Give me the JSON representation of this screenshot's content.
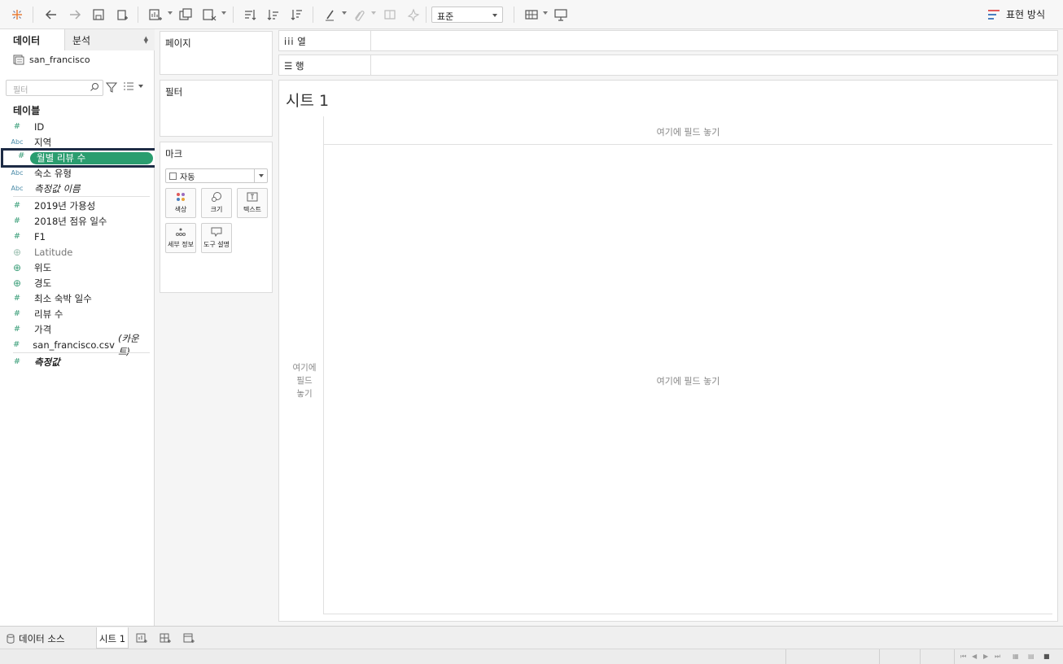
{
  "toolbar": {
    "fit_value": "표준",
    "show_me_label": "표현 방식"
  },
  "data_pane": {
    "tab_data": "데이터",
    "tab_analysis": "분석",
    "datasource_name": "san_francisco",
    "search_placeholder": "필터",
    "tables_header": "테이블",
    "fields": [
      {
        "label": "ID",
        "type": "measure"
      },
      {
        "label": "지역",
        "type": "dimension"
      },
      {
        "label": "월별 리뷰 수",
        "type": "measure",
        "selected": true
      },
      {
        "label": "숙소 유형",
        "type": "dimension"
      },
      {
        "label": "측정값 이름",
        "type": "dimension",
        "italic": true
      },
      {
        "label": "2019년 가용성",
        "type": "measure"
      },
      {
        "label": "2018년 점유 일수",
        "type": "measure"
      },
      {
        "label": "F1",
        "type": "measure"
      },
      {
        "label": "Latitude",
        "type": "geo"
      },
      {
        "label": "위도",
        "type": "geo"
      },
      {
        "label": "경도",
        "type": "geo"
      },
      {
        "label": "최소 숙박 일수",
        "type": "measure"
      },
      {
        "label": "리뷰 수",
        "type": "measure"
      },
      {
        "label": "가격",
        "type": "measure"
      },
      {
        "label": "san_francisco.csv",
        "suffix": "(카운트)",
        "type": "measure"
      },
      {
        "label": "측정값",
        "type": "measure",
        "italic": true
      }
    ]
  },
  "shelves": {
    "pages": "페이지",
    "filters": "필터",
    "marks": "마크",
    "mark_type": "자동",
    "mark_buttons": {
      "color": "색상",
      "size": "크기",
      "text": "텍스트",
      "detail": "세부 정보",
      "tooltip": "도구 설명"
    },
    "columns": "열",
    "rows": "행"
  },
  "canvas": {
    "sheet_title": "시트 1",
    "drop_field_cols": "여기에 필드 놓기",
    "drop_field_rows_1": "여기에",
    "drop_field_rows_2": "필드",
    "drop_field_rows_3": "놓기",
    "drop_field_main": "여기에 필드 놓기"
  },
  "bottom": {
    "datasource_tab": "데이터 소스",
    "sheet_tab": "시트 1"
  },
  "colors": {
    "measure_green": "#2a9d6f",
    "dimension_blue": "#4a8ba8",
    "selection_border": "#1d2b45"
  }
}
